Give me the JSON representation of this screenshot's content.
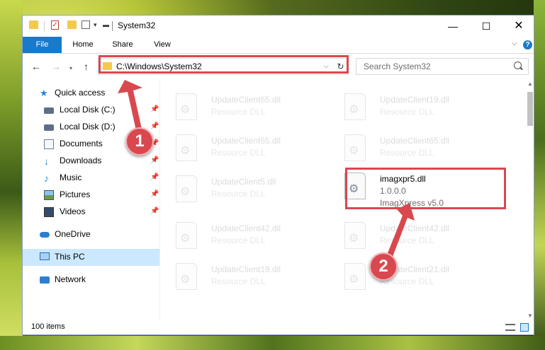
{
  "window": {
    "title": "System32",
    "controls": {
      "minimize": "—",
      "maximize": "☐",
      "close": "✕"
    }
  },
  "ribbon": {
    "tabs": [
      {
        "label": "File"
      },
      {
        "label": "Home"
      },
      {
        "label": "Share"
      },
      {
        "label": "View"
      }
    ],
    "help": "?"
  },
  "nav": {
    "back": "←",
    "forward": "→",
    "recent": "▾",
    "up": "↑",
    "address": "C:\\Windows\\System32",
    "address_dropdown": "⌵",
    "refresh": "↻",
    "search_placeholder": "Search System32"
  },
  "sidebar": {
    "items": [
      {
        "label": "Quick access",
        "icon": "star-icon"
      },
      {
        "label": "Local Disk (C:)",
        "icon": "disk-icon",
        "pinned": true
      },
      {
        "label": "Local Disk (D:)",
        "icon": "disk-icon",
        "pinned": true
      },
      {
        "label": "Documents",
        "icon": "documents-icon",
        "pinned": true
      },
      {
        "label": "Downloads",
        "icon": "download-icon",
        "pinned": true
      },
      {
        "label": "Music",
        "icon": "music-icon",
        "pinned": true
      },
      {
        "label": "Pictures",
        "icon": "pictures-icon",
        "pinned": true
      },
      {
        "label": "Videos",
        "icon": "videos-icon",
        "pinned": true
      },
      {
        "label": "OneDrive",
        "icon": "cloud-icon"
      },
      {
        "label": "This PC",
        "icon": "pc-icon",
        "selected": true
      },
      {
        "label": "Network",
        "icon": "network-icon"
      }
    ],
    "pin_glyph": "📌"
  },
  "files": [
    {
      "name": "UpdateClient65.dll",
      "desc": "Resource DLL"
    },
    {
      "name": "UpdateClient19.dll",
      "desc": "Resource DLL"
    },
    {
      "name": "UpdateClient65.dll",
      "desc": "Resource DLL"
    },
    {
      "name": "UpdateClient65.dll",
      "desc": "Resource DLL"
    },
    {
      "name": "UpdateClient5.dll",
      "desc": "Resource DLL"
    },
    {
      "name": "imagxpr5.dll",
      "desc": "1.0.0.0",
      "desc2": "ImagXpress v5.0",
      "highlight": true
    },
    {
      "name": "UpdateClient42.dll",
      "desc": "Resource DLL"
    },
    {
      "name": "UpdateClient42.dll",
      "desc": "Resource DLL"
    },
    {
      "name": "UpdateClient19.dll",
      "desc": "Resource DLL"
    },
    {
      "name": "UpdateClient21.dll",
      "desc": "Resource DLL"
    }
  ],
  "status": {
    "item_count": "100 items"
  },
  "annotations": {
    "badge1": "1",
    "badge2": "2",
    "color": "#d9484f"
  },
  "colors": {
    "accent": "#1979ca",
    "selection": "#cce8ff"
  }
}
